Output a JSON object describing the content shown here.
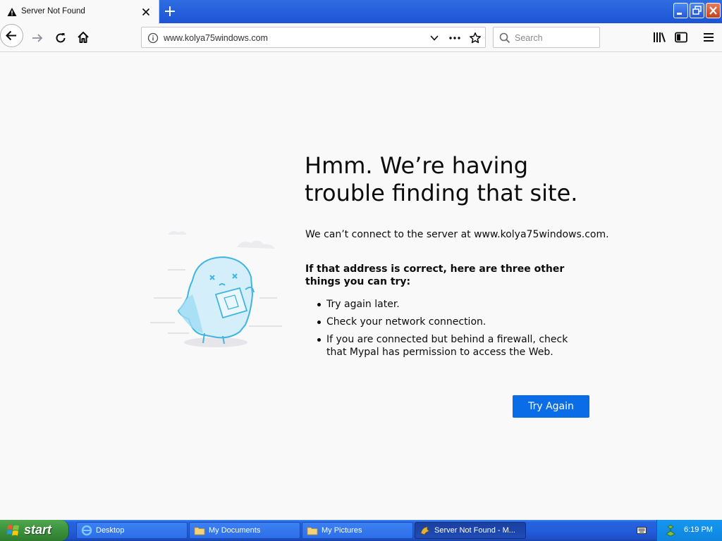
{
  "tab": {
    "title": "Server Not Found",
    "close_label": "×",
    "new_tab_label": "+"
  },
  "toolbar": {
    "url": "www.kolya75windows.com",
    "search_placeholder": "Search"
  },
  "error": {
    "title": "Hmm. We’re having trouble finding that site.",
    "description": "We can’t connect to the server at www.kolya75windows.com.",
    "tips_heading": "If that address is correct, here are three other things you can try:",
    "tips": [
      "Try again later.",
      "Check your network connection.",
      "If you are connected but behind a firewall, check that Mypal has permission to access the Web."
    ],
    "button_label": "Try Again",
    "accent_color": "#0a6ce6"
  },
  "taskbar": {
    "start_label": "start",
    "tasks": [
      {
        "label": "Desktop",
        "icon": "ie-icon"
      },
      {
        "label": "My Documents",
        "icon": "folder-icon"
      },
      {
        "label": "My Pictures",
        "icon": "folder-icon"
      },
      {
        "label": "Server Not Found - M...",
        "icon": "mypal-icon",
        "active": true
      }
    ],
    "clock": "6:19 PM"
  }
}
